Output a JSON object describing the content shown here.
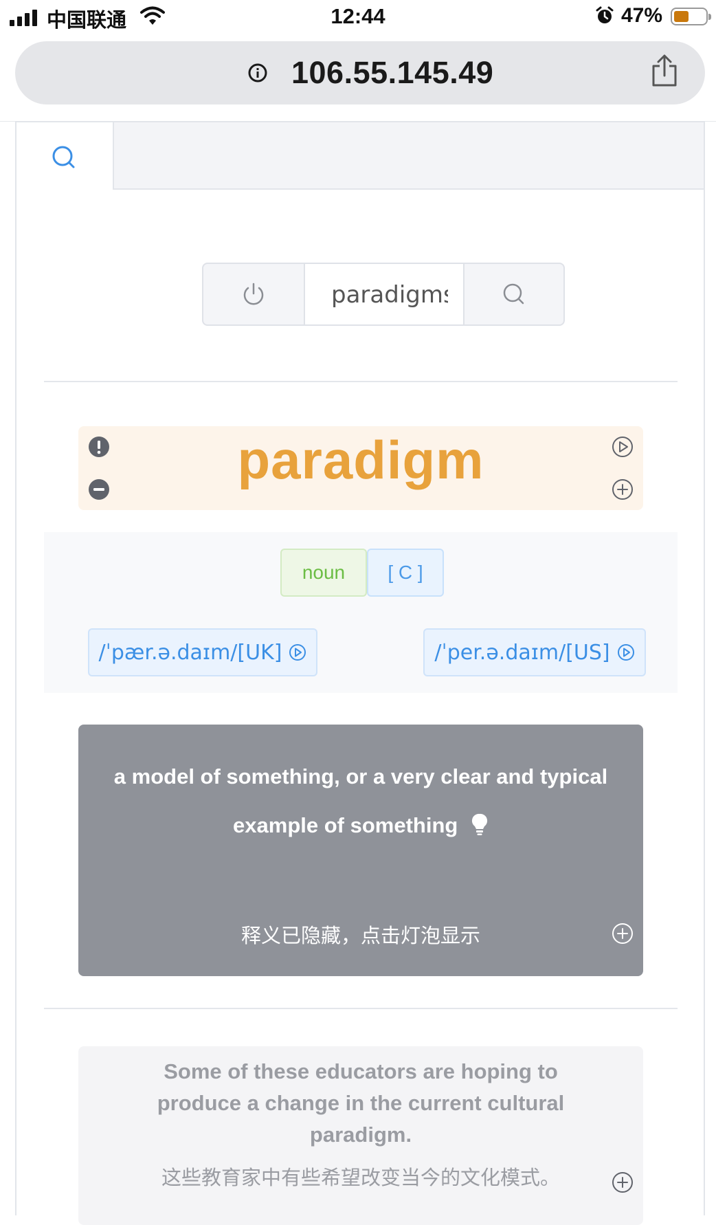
{
  "status_bar": {
    "carrier": "中国联通",
    "time": "12:44",
    "battery_percent": "47%",
    "battery_level": 0.47
  },
  "browser": {
    "url": "106.55.145.49"
  },
  "search": {
    "value": "paradigms"
  },
  "entry": {
    "word": "paradigm",
    "part_of_speech": "noun",
    "grammar": "[ C ]",
    "pronunciation_uk": "/ˈpær.ə.daɪm/[UK]",
    "pronunciation_us": "/ˈper.ə.daɪm/[US]",
    "definition": "a model of something, or a very clear and typical example of something",
    "definition_hint": "释义已隐藏，点击灯泡显示",
    "example_en": "Some of these educators are hoping to produce a change in the current cultural paradigm.",
    "example_zh": "这些教育家中有些希望改变当今的文化模式。"
  },
  "colors": {
    "word": "#e8a23c",
    "noun_tag": "#6bbd44",
    "grammar_tag": "#4c9ae8",
    "definition_card": "#8f9299",
    "accent_blue": "#3b8fe5"
  }
}
